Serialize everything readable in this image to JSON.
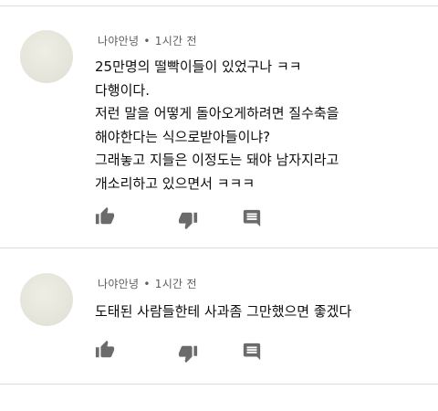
{
  "comments": [
    {
      "author": "나야안녕",
      "separator": "•",
      "time": "1시간 전",
      "lines": [
        "25만명의 떨빡이들이 있었구나 ㅋㅋ",
        "다행이다.",
        "저런 말을 어떻게 돌아오게하려면 질수축을",
        "해야한다는 식으로받아들이냐?",
        "그래놓고 지들은 이정도는 돼야 남자지라고",
        "개소리하고 있으면서 ㅋㅋㅋ"
      ],
      "actions": [
        "thumb-up-icon",
        "thumb-down-icon",
        "reply-icon"
      ]
    },
    {
      "author": "나야안녕",
      "separator": "•",
      "time": "1시간 전",
      "lines": [
        "도태된 사람들한테 사과좀 그만했으면 좋겠다"
      ],
      "actions": [
        "thumb-up-icon",
        "thumb-down-icon",
        "reply-icon"
      ]
    }
  ],
  "colors": {
    "meta_text": "#606060",
    "icon": "#6b6b6b",
    "divider": "#dcdcdc",
    "avatar": "#e6e5db"
  }
}
